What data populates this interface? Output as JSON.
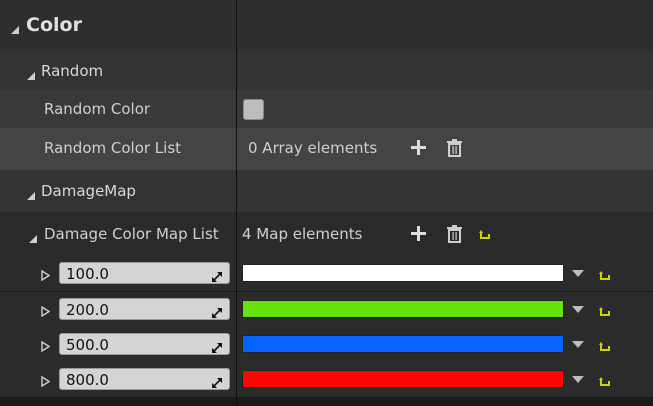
{
  "sections": {
    "color": {
      "title": "Color"
    },
    "random": {
      "title": "Random"
    },
    "damage_map": {
      "title": "DamageMap"
    }
  },
  "random": {
    "random_color_label": "Random Color",
    "random_color_checked": false,
    "random_color_list_label": "Random Color List",
    "random_color_list_value": "0 Array elements"
  },
  "damage": {
    "list_label": "Damage Color Map List",
    "list_value": "4 Map elements",
    "entries": [
      {
        "key": "100.0",
        "color": "#ffffff"
      },
      {
        "key": "200.0",
        "color": "#66e30a"
      },
      {
        "key": "500.0",
        "color": "#0663ff"
      },
      {
        "key": "800.0",
        "color": "#ff0404"
      }
    ]
  },
  "icons": {
    "add": "plus-icon",
    "delete": "trash-icon",
    "reset": "reset-arrow-icon",
    "expand": "expand-triangle-icon",
    "collapse": "collapse-triangle-icon",
    "dropdown": "dropdown-arrow-icon",
    "picker": "eyedropper-icon"
  },
  "colors": {
    "panel_bg": "#1a1a1a",
    "category_bg": "#2f2f2f",
    "row_bg": "#383838",
    "row_alt_bg": "#3e3e3e",
    "reset_yellow": "#d2d200"
  }
}
